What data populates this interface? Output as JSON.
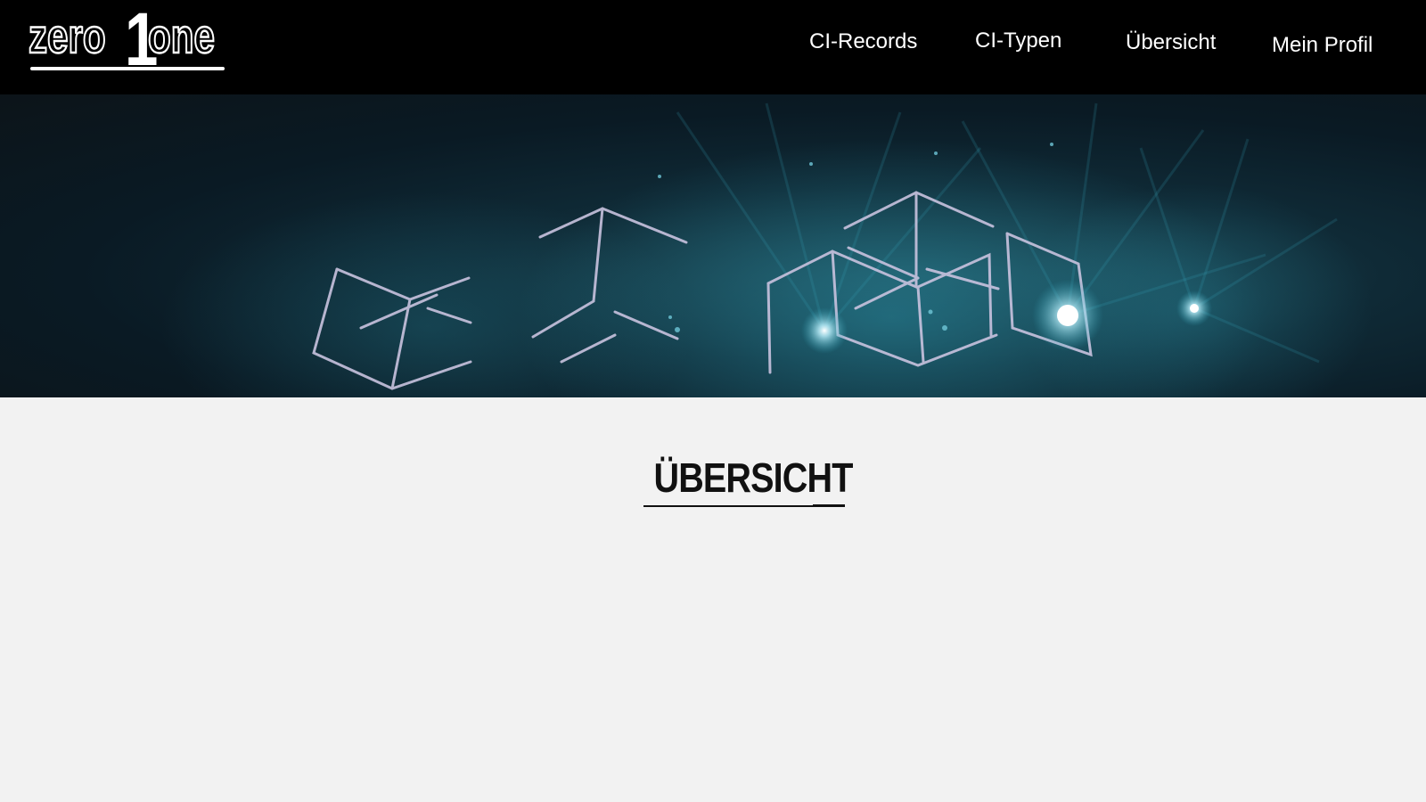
{
  "logo": {
    "left_word": "zero",
    "digit": "1",
    "right_word": "one"
  },
  "nav": {
    "items": [
      {
        "label": "CI-Records"
      },
      {
        "label": "CI-Typen"
      },
      {
        "label": "Übersicht"
      },
      {
        "label": "Mein Profil"
      }
    ]
  },
  "page": {
    "title": "ÜBERSICHT"
  },
  "colors": {
    "navbar_bg": "#000000",
    "nav_text": "#ffffff",
    "page_bg": "#f2f2f2",
    "title_text": "#111111",
    "hero_glow": "#2fa3b8"
  }
}
